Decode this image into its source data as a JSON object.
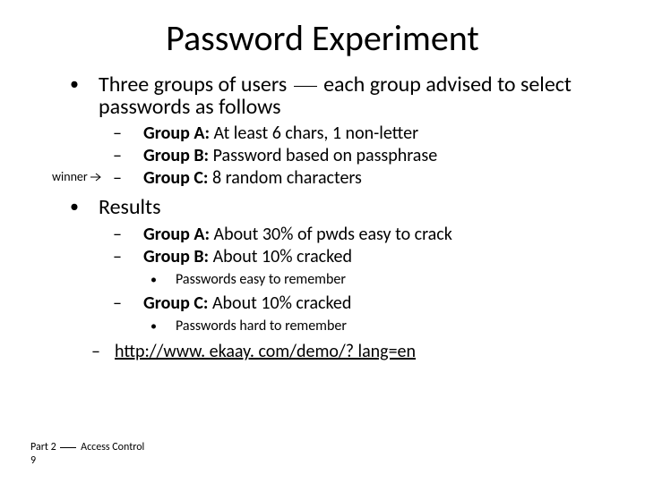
{
  "title": "Password Experiment",
  "intro": {
    "pre": "Three groups of users",
    "post": "each group advised to select passwords as follows"
  },
  "groups": [
    {
      "label": "Group A:",
      "desc": " At least 6 chars, 1 non-letter"
    },
    {
      "label": "Group B:",
      "desc": " Password based on passphrase"
    },
    {
      "label": "Group C:",
      "desc": " 8 random characters"
    }
  ],
  "winner": "winner",
  "results_label": "Results",
  "results": {
    "a": {
      "label": "Group A:",
      "desc": " About 30% of pwds easy to crack"
    },
    "b": {
      "label": "Group B:",
      "desc": " About 10% cracked",
      "note": "Passwords easy to remember"
    },
    "c": {
      "label": "Group C:",
      "desc": " About 10% cracked",
      "note": "Passwords hard to remember"
    }
  },
  "link": "http://www. ekaay. com/demo/? lang=en",
  "footer": {
    "line1_pre": "Part 2",
    "line1_post": "Access Control",
    "pagenum": "9"
  }
}
